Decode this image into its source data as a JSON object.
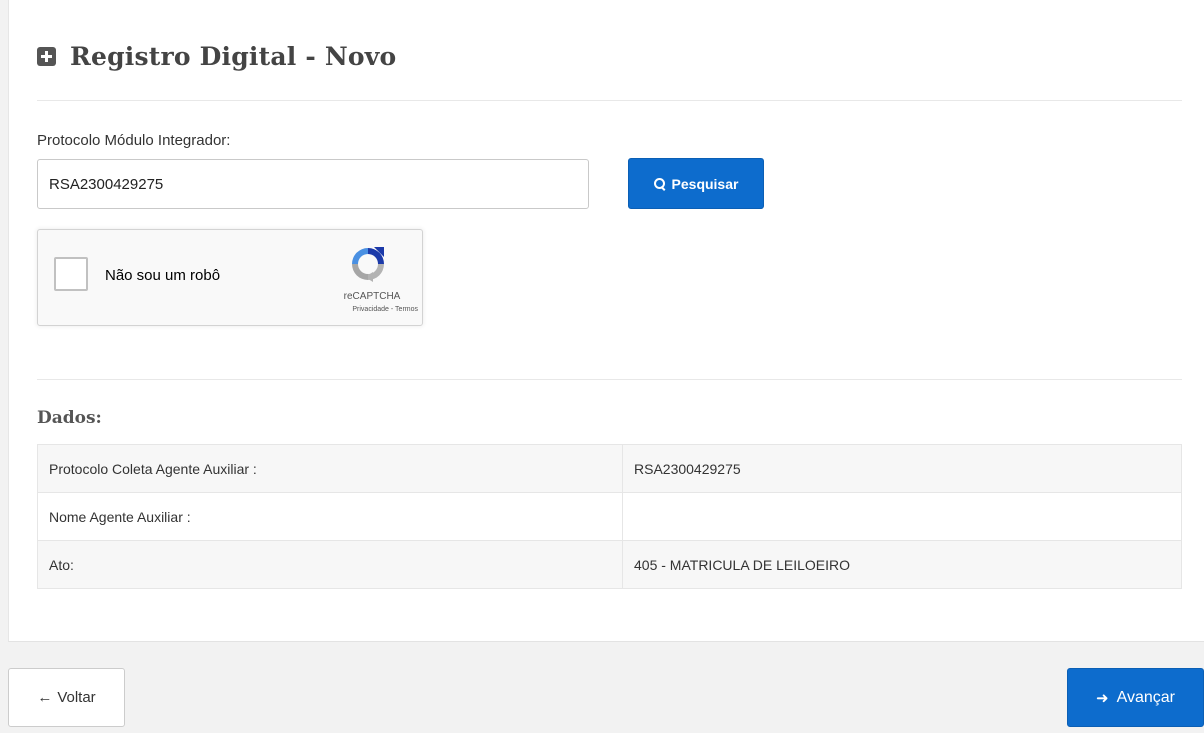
{
  "header": {
    "title": "Registro Digital - Novo",
    "icon": "plus-square-icon"
  },
  "search": {
    "label": "Protocolo Módulo Integrador:",
    "value": "RSA2300429275",
    "button_label": "Pesquisar",
    "button_icon": "search-icon"
  },
  "captcha": {
    "label": "Não sou um robô",
    "brand": "reCAPTCHA",
    "links": "Privacidade - Termos"
  },
  "data_section": {
    "title": "Dados:",
    "rows": [
      {
        "key": "Protocolo Coleta Agente Auxiliar :",
        "value": "RSA2300429275"
      },
      {
        "key": "Nome Agente Auxiliar :",
        "value": ""
      },
      {
        "key": "Ato:",
        "value": "405 - MATRICULA DE LEILOEIRO"
      }
    ]
  },
  "footer": {
    "back_label": "Voltar",
    "next_label": "Avançar",
    "back_icon": "arrow-left-icon",
    "next_icon": "arrow-right-icon"
  },
  "colors": {
    "primary": "#0d6ccd",
    "page_background": "#f2f2f2",
    "panel_background": "#ffffff",
    "table_stripe": "#f7f7f7"
  }
}
